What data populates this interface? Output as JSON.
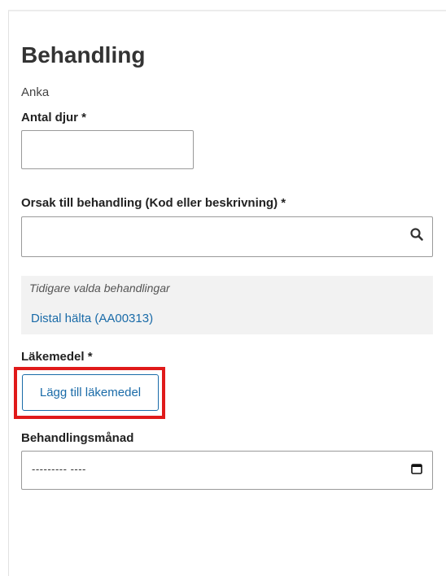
{
  "form": {
    "title": "Behandling",
    "species": "Anka",
    "animal_count": {
      "label": "Antal djur *",
      "value": ""
    },
    "reason": {
      "label": "Orsak till behandling (Kod eller beskrivning) *",
      "value": "",
      "icon": "search-icon"
    },
    "previous_treatments": {
      "heading": "Tidigare valda behandlingar",
      "items": [
        "Distal hälta (AA00313)"
      ]
    },
    "medicine": {
      "label": "Läkemedel *",
      "add_button": "Lägg till läkemedel"
    },
    "treatment_month": {
      "label": "Behandlingsmånad",
      "value": "--------- ----",
      "icon": "calendar-icon"
    }
  },
  "colors": {
    "link": "#1a6ba8",
    "highlight": "#e01a1a",
    "previous_bg": "#f2f2f2"
  }
}
